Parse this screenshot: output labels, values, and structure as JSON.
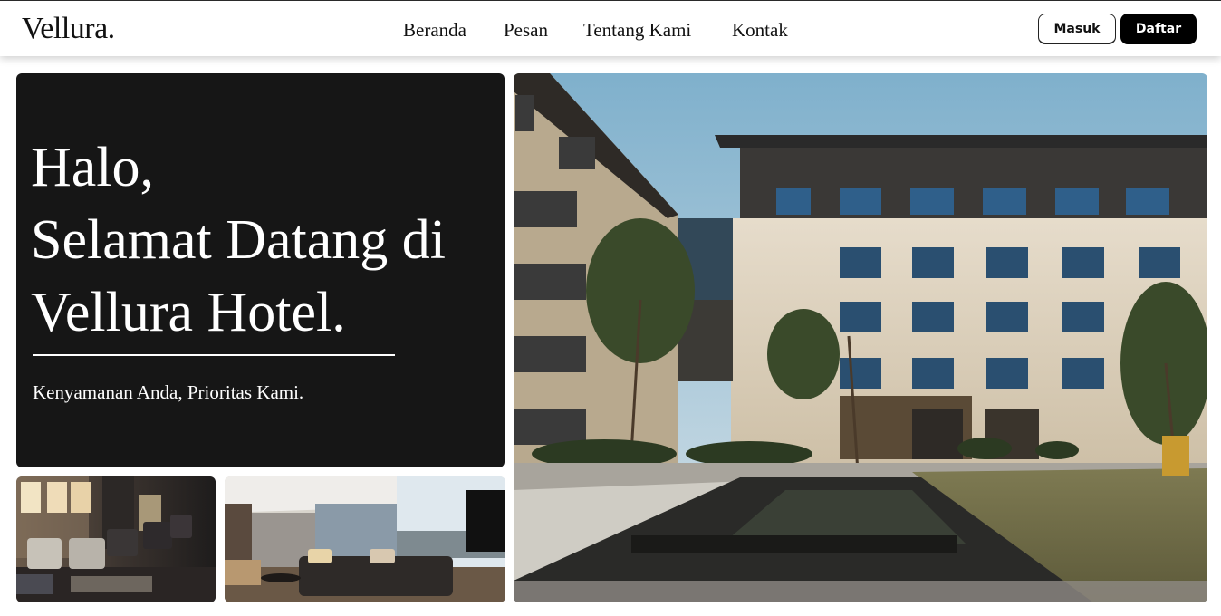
{
  "brand": {
    "logo_text": "Vellura."
  },
  "nav": {
    "items": [
      {
        "label": "Beranda"
      },
      {
        "label": "Pesan"
      },
      {
        "label": "Tentang Kami"
      },
      {
        "label": "Kontak"
      }
    ]
  },
  "auth": {
    "login_label": "Masuk",
    "register_label": "Daftar"
  },
  "hero": {
    "line1": "Halo,",
    "line2": "Selamat Datang di",
    "line3": "Vellura Hotel.",
    "tagline": "Kenyamanan Anda, Prioritas Kami."
  },
  "gallery": {
    "images": [
      {
        "icon": "lobby-photo"
      },
      {
        "icon": "suite-photo"
      },
      {
        "icon": "hotel-building-photo"
      }
    ]
  },
  "colors": {
    "hero_bg": "#161616",
    "primary_button": "#000000",
    "page_bg": "#ffffff"
  }
}
